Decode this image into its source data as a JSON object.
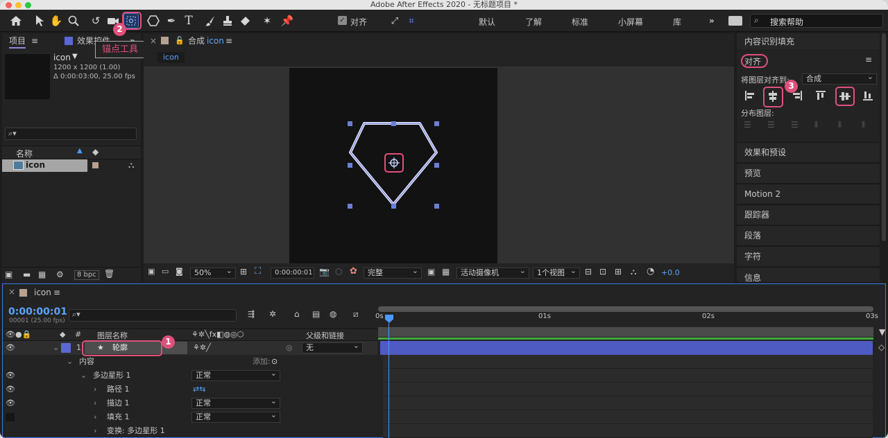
{
  "window": {
    "title": "Adobe After Effects 2020 - 无标题项目 *"
  },
  "toolbar": {
    "align_checkbox_label": "对齐",
    "workspaces": [
      "默认",
      "了解",
      "标准",
      "小屏幕",
      "库"
    ],
    "more_icon": "»",
    "search_placeholder": "搜索帮助",
    "tools": [
      "home-icon",
      "selection-tool-icon",
      "hand-tool-icon",
      "zoom-tool-icon",
      "rotate-tool-icon",
      "camera-tool-icon",
      "anchor-point-tool-icon",
      "polygon-tool-icon",
      "pen-tool-icon",
      "type-tool-icon",
      "brush-tool-icon",
      "clone-stamp-icon",
      "eraser-icon",
      "puppet-tool-icon",
      "pin-icon"
    ]
  },
  "tooltip": {
    "text": "锚点工具"
  },
  "badges": {
    "one": "1",
    "two": "2",
    "three": "3"
  },
  "project_panel": {
    "tab_project": "项目",
    "tab_effects": "效果控件",
    "item_name": "icon",
    "item_dims": "1200 x 1200 (1.00)",
    "item_duration": "Δ 0:00:03:00, 25.00 fps",
    "search_icon": "⌕▾",
    "col_name": "名称",
    "list_item": "icon",
    "bpc": "8 bpc"
  },
  "comp_panel": {
    "tab_label": "合成",
    "tab_comp_name": "icon",
    "breadcrumb": "icon",
    "zoom": "50%",
    "timecode": "0:00:00:01",
    "resolution": "完整",
    "camera": "活动摄像机",
    "views": "1个视图",
    "exposure": "+0.0"
  },
  "right_panel": {
    "content_aware_fill": "内容识别填充",
    "align_title": "对齐",
    "align_to_label": "将图层对齐到:",
    "align_to_value": "合成",
    "distribute_label": "分布图层:",
    "items": [
      "效果和预设",
      "预览",
      "Motion 2",
      "跟踪器",
      "段落",
      "字符",
      "信息"
    ]
  },
  "timeline": {
    "tab_name": "icon",
    "timecode": "0:00:00:01",
    "frame_info": "00001 (25.00 fps)",
    "col_number": "#",
    "col_layer_name": "图层名称",
    "col_parent": "父级和链接",
    "layer_number": "1",
    "layer_name": "轮廓",
    "parent_value": "无",
    "content_label": "内容",
    "add_label": "添加:",
    "polystar_label": "多边星形 1",
    "polystar_mode": "正常",
    "path_label": "路径 1",
    "stroke_label": "描边 1",
    "stroke_mode": "正常",
    "fill_label": "填充 1",
    "fill_mode": "正常",
    "transform_label": "变换: 多边星形 1",
    "ruler": [
      "0s",
      "01s",
      "02s",
      "03s"
    ]
  }
}
